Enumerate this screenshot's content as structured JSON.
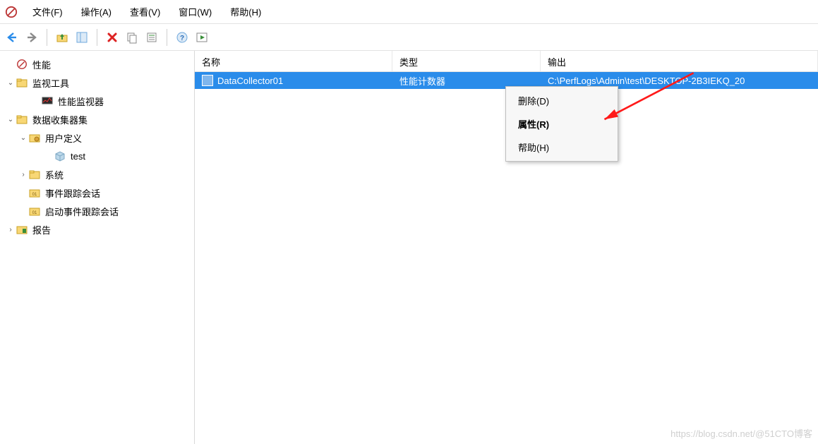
{
  "menu": {
    "file": "文件(F)",
    "action": "操作(A)",
    "view": "查看(V)",
    "window": "窗口(W)",
    "help": "帮助(H)"
  },
  "tree": {
    "root": "性能",
    "monitor_tools": "监视工具",
    "perf_monitor": "性能监视器",
    "collector_sets": "数据收集器集",
    "user_defined": "用户定义",
    "user_defined_item": "test",
    "system": "系统",
    "et_sessions": "事件跟踪会话",
    "startup_et": "启动事件跟踪会话",
    "reports": "报告"
  },
  "list": {
    "columns": {
      "name": "名称",
      "type": "类型",
      "output": "输出"
    },
    "rows": [
      {
        "name": "DataCollector01",
        "type": "性能计数器",
        "output": "C:\\PerfLogs\\Admin\\test\\DESKTOP-2B3IEKQ_20"
      }
    ]
  },
  "context_menu": {
    "delete": "删除(D)",
    "properties": "属性(R)",
    "help": "帮助(H)"
  },
  "watermark": "https://blog.csdn.net/@51CTO博客"
}
